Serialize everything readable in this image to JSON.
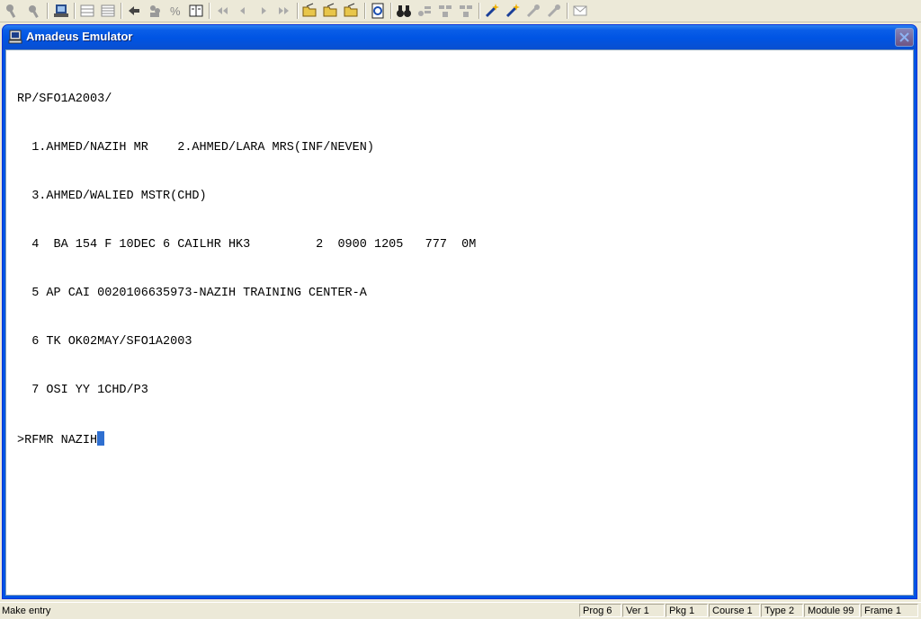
{
  "toolbar": {
    "icons": [
      "tool-icon-1",
      "tool-icon-2",
      "printer-icon",
      "grid-icon-1",
      "grid-icon-2",
      "hand-icon",
      "group-icon",
      "percent-icon",
      "book-icon",
      "first-icon",
      "prev-icon",
      "next-icon",
      "last-icon",
      "folder-open-icon-1",
      "folder-open-icon-2",
      "folder-open-icon-3",
      "refresh-icon",
      "binoculars-icon",
      "find-icon-1",
      "find-icon-2",
      "find-icon-3",
      "wand-icon-1",
      "wand-icon-2",
      "tool-icon-3",
      "tool-icon-4",
      "mail-icon"
    ]
  },
  "window": {
    "title": "Amadeus Emulator"
  },
  "terminal": {
    "lines": [
      "RP/SFO1A2003/",
      "  1.AHMED/NAZIH MR    2.AHMED/LARA MRS(INF/NEVEN)",
      "  3.AHMED/WALIED MSTR(CHD)",
      "  4  BA 154 F 10DEC 6 CAILHR HK3         2  0900 1205   777  0M",
      "  5 AP CAI 0020106635973-NAZIH TRAINING CENTER-A",
      "  6 TK OK02MAY/SFO1A2003",
      "  7 OSI YY 1CHD/P3"
    ],
    "command": ">RFMR NAZIH"
  },
  "statusbar": {
    "message": "Make entry",
    "prog": "Prog 6",
    "ver": "Ver 1",
    "pkg": "Pkg 1",
    "course": "Course 1",
    "type": "Type 2",
    "module": "Module 99",
    "frame": "Frame 1"
  }
}
